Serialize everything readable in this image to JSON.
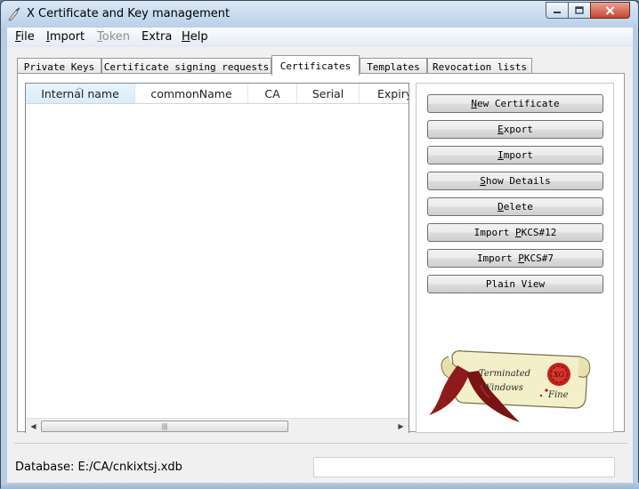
{
  "window": {
    "title": "X Certificate and Key management"
  },
  "menu": [
    {
      "label": "File",
      "mnemonic": "F",
      "rest": "ile",
      "enabled": true
    },
    {
      "label": "Import",
      "mnemonic": "I",
      "rest": "mport",
      "enabled": true
    },
    {
      "label": "Token",
      "mnemonic": "T",
      "rest": "oken",
      "enabled": false
    },
    {
      "label": "Extra",
      "mnemonic": "",
      "rest": "Extra",
      "enabled": true
    },
    {
      "label": "Help",
      "mnemonic": "H",
      "rest": "elp",
      "enabled": true
    }
  ],
  "tabs": [
    {
      "label": "Private Keys",
      "active": false
    },
    {
      "label": "Certificate signing requests",
      "active": false
    },
    {
      "label": "Certificates",
      "active": true
    },
    {
      "label": "Templates",
      "active": false
    },
    {
      "label": "Revocation lists",
      "active": false
    }
  ],
  "table": {
    "columns": [
      "Internal name",
      "commonName",
      "CA",
      "Serial",
      "Expiry"
    ],
    "sorted_column": "Internal name",
    "rows": []
  },
  "buttons": [
    {
      "label": "New Certificate",
      "pre": "",
      "mn": "N",
      "post": "ew Certificate"
    },
    {
      "label": "Export",
      "pre": "",
      "mn": "E",
      "post": "xport"
    },
    {
      "label": "Import",
      "pre": "",
      "mn": "I",
      "post": "mport"
    },
    {
      "label": "Show Details",
      "pre": "",
      "mn": "S",
      "post": "how Details"
    },
    {
      "label": "Delete",
      "pre": "",
      "mn": "D",
      "post": "elete"
    },
    {
      "label": "Import PKCS#12",
      "pre": "Import ",
      "mn": "P",
      "post": "KCS#12"
    },
    {
      "label": "Import PKCS#7",
      "pre": "Import ",
      "mn": "P",
      "post": "KCS#7"
    },
    {
      "label": "Plain View",
      "pre": "",
      "mn": "",
      "post": "Plain View"
    }
  ],
  "logo": {
    "line1": "Terminated",
    "line2": "Windows",
    "line3": "Fine",
    "seal": "XG"
  },
  "status": {
    "database_label": "Database: E:/CA/cnkixtsj.xdb",
    "field_value": ""
  },
  "colors": {
    "title_bar": "#b9d0e8",
    "close_button": "#c5472f",
    "sorted_header": "#d7ecfb"
  }
}
